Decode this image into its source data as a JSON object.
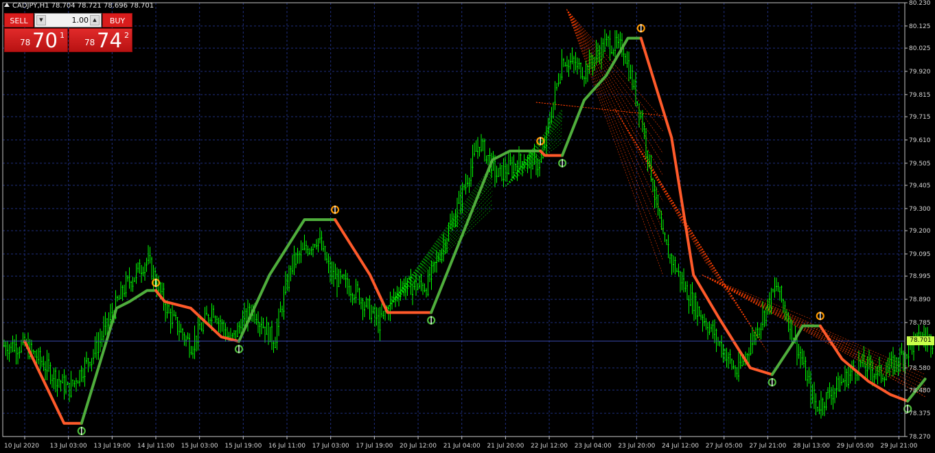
{
  "header": {
    "symbol_info": "CADJPY,H1  78.704 78.721 78.696 78.701"
  },
  "trade_panel": {
    "sell_label": "SELL",
    "buy_label": "BUY",
    "lot_value": "1.00",
    "sell_price_small": "78",
    "sell_price_big": "70",
    "sell_price_sup": "1",
    "buy_price_small": "78",
    "buy_price_big": "74",
    "buy_price_sup": "2"
  },
  "colors": {
    "background": "#000000",
    "grid": "#1f2f80",
    "bull_candle": "#00ff00",
    "trend_up": "#4fae3c",
    "trend_down": "#ff5a2a",
    "fan_up": "#00c800",
    "fan_down": "#ff4000",
    "current_price_bg": "#c9ff4a",
    "panel_red": "#d91c1c",
    "signal_icon": "#ff9900"
  },
  "chart_data": {
    "type": "line",
    "title": "",
    "xlabel": "",
    "ylabel": "",
    "ylim": [
      78.27,
      80.23
    ],
    "grid": true,
    "y_ticks": [
      "80.230",
      "80.125",
      "80.025",
      "79.920",
      "79.815",
      "79.715",
      "79.610",
      "79.505",
      "79.405",
      "79.300",
      "79.200",
      "79.095",
      "78.995",
      "78.890",
      "78.785",
      "78.580",
      "78.480",
      "78.375",
      "78.270"
    ],
    "current_price": "78.701",
    "x_ticks": [
      "10 Jul 2020",
      "13 Jul 03:00",
      "13 Jul 19:00",
      "14 Jul 11:00",
      "15 Jul 03:00",
      "15 Jul 19:00",
      "16 Jul 11:00",
      "17 Jul 03:00",
      "17 Jul 19:00",
      "20 Jul 12:00",
      "21 Jul 04:00",
      "21 Jul 20:00",
      "22 Jul 12:00",
      "23 Jul 04:00",
      "23 Jul 20:00",
      "24 Jul 12:00",
      "27 Jul 05:00",
      "27 Jul 21:00",
      "28 Jul 13:00",
      "29 Jul 05:00",
      "29 Jul 21:00"
    ],
    "price_series": [
      {
        "x": 0,
        "y": 78.68
      },
      {
        "x": 1,
        "y": 78.48
      },
      {
        "x": 1.6,
        "y": 78.66
      },
      {
        "x": 2.3,
        "y": 78.95
      },
      {
        "x": 2.8,
        "y": 79.07
      },
      {
        "x": 3.3,
        "y": 78.82
      },
      {
        "x": 3.8,
        "y": 78.68
      },
      {
        "x": 4.3,
        "y": 78.85
      },
      {
        "x": 4.7,
        "y": 78.7
      },
      {
        "x": 5.2,
        "y": 78.85
      },
      {
        "x": 5.7,
        "y": 78.7
      },
      {
        "x": 6.1,
        "y": 79.05
      },
      {
        "x": 6.7,
        "y": 79.17
      },
      {
        "x": 7.0,
        "y": 79.0
      },
      {
        "x": 7.6,
        "y": 78.92
      },
      {
        "x": 8.1,
        "y": 78.78
      },
      {
        "x": 8.6,
        "y": 78.95
      },
      {
        "x": 9.2,
        "y": 78.95
      },
      {
        "x": 9.8,
        "y": 79.25
      },
      {
        "x": 10.4,
        "y": 79.6
      },
      {
        "x": 10.8,
        "y": 79.45
      },
      {
        "x": 11.4,
        "y": 79.52
      },
      {
        "x": 11.8,
        "y": 79.5
      },
      {
        "x": 12.3,
        "y": 79.98
      },
      {
        "x": 12.8,
        "y": 79.92
      },
      {
        "x": 13.3,
        "y": 80.05
      },
      {
        "x": 13.7,
        "y": 80.02
      },
      {
        "x": 14.1,
        "y": 79.72
      },
      {
        "x": 14.6,
        "y": 79.15
      },
      {
        "x": 15.2,
        "y": 78.9
      },
      {
        "x": 15.8,
        "y": 78.72
      },
      {
        "x": 16.3,
        "y": 78.55
      },
      {
        "x": 16.8,
        "y": 78.78
      },
      {
        "x": 17.2,
        "y": 78.95
      },
      {
        "x": 17.6,
        "y": 78.72
      },
      {
        "x": 18.1,
        "y": 78.4
      },
      {
        "x": 18.6,
        "y": 78.5
      },
      {
        "x": 19.1,
        "y": 78.6
      },
      {
        "x": 19.6,
        "y": 78.55
      },
      {
        "x": 20.0,
        "y": 78.62
      },
      {
        "x": 20.5,
        "y": 78.72
      },
      {
        "x": 20.8,
        "y": 78.7
      }
    ],
    "trend_segments": [
      {
        "dir": "down",
        "points": [
          [
            0,
            78.7
          ],
          [
            0.9,
            78.33
          ],
          [
            1.3,
            78.33
          ]
        ]
      },
      {
        "dir": "up",
        "points": [
          [
            1.3,
            78.33
          ],
          [
            2.1,
            78.85
          ],
          [
            2.4,
            78.88
          ],
          [
            2.8,
            78.93
          ],
          [
            3.0,
            78.93
          ]
        ]
      },
      {
        "dir": "down",
        "points": [
          [
            3.0,
            78.93
          ],
          [
            3.2,
            78.88
          ],
          [
            3.8,
            78.85
          ],
          [
            4.5,
            78.72
          ],
          [
            4.9,
            78.7
          ]
        ]
      },
      {
        "dir": "up",
        "points": [
          [
            4.9,
            78.7
          ],
          [
            5.6,
            79.0
          ],
          [
            6.4,
            79.25
          ],
          [
            7.1,
            79.25
          ]
        ]
      },
      {
        "dir": "down",
        "points": [
          [
            7.1,
            79.25
          ],
          [
            7.9,
            79.0
          ],
          [
            8.3,
            78.83
          ],
          [
            9.3,
            78.83
          ]
        ]
      },
      {
        "dir": "up",
        "points": [
          [
            9.3,
            78.83
          ],
          [
            10.7,
            79.52
          ],
          [
            11.1,
            79.56
          ],
          [
            11.8,
            79.56
          ]
        ]
      },
      {
        "dir": "down",
        "points": [
          [
            11.8,
            79.56
          ],
          [
            11.9,
            79.54
          ],
          [
            12.3,
            79.54
          ]
        ]
      },
      {
        "dir": "up",
        "points": [
          [
            12.3,
            79.54
          ],
          [
            12.8,
            79.79
          ],
          [
            13.3,
            79.9
          ],
          [
            13.8,
            80.07
          ],
          [
            14.1,
            80.07
          ]
        ]
      },
      {
        "dir": "down",
        "points": [
          [
            14.1,
            80.07
          ],
          [
            14.8,
            79.62
          ],
          [
            15.3,
            79.0
          ],
          [
            15.9,
            78.8
          ],
          [
            16.6,
            78.58
          ],
          [
            17.1,
            78.55
          ]
        ]
      },
      {
        "dir": "up",
        "points": [
          [
            17.1,
            78.55
          ],
          [
            17.6,
            78.7
          ],
          [
            17.8,
            78.77
          ],
          [
            18.2,
            78.77
          ]
        ]
      },
      {
        "dir": "down",
        "points": [
          [
            18.2,
            78.77
          ],
          [
            18.7,
            78.62
          ],
          [
            19.3,
            78.52
          ],
          [
            19.8,
            78.46
          ],
          [
            20.2,
            78.43
          ]
        ]
      },
      {
        "dir": "up",
        "points": [
          [
            20.2,
            78.43
          ],
          [
            20.6,
            78.53
          ]
        ]
      }
    ],
    "signals": [
      {
        "kind": "down",
        "x": 3.0,
        "y": 78.94
      },
      {
        "kind": "up",
        "x": 1.3,
        "y": 78.32
      },
      {
        "kind": "up",
        "x": 4.9,
        "y": 78.69
      },
      {
        "kind": "down",
        "x": 7.1,
        "y": 79.27
      },
      {
        "kind": "up",
        "x": 9.3,
        "y": 78.82
      },
      {
        "kind": "down",
        "x": 11.8,
        "y": 79.58
      },
      {
        "kind": "up",
        "x": 12.3,
        "y": 79.53
      },
      {
        "kind": "down",
        "x": 14.1,
        "y": 80.09
      },
      {
        "kind": "up",
        "x": 17.1,
        "y": 78.54
      },
      {
        "kind": "down",
        "x": 18.2,
        "y": 78.79
      },
      {
        "kind": "up",
        "x": 20.2,
        "y": 78.42
      }
    ],
    "fans": [
      {
        "dir": "up",
        "origin": [
          8.3,
          78.85
        ],
        "targets": [
          [
            10.7,
            79.3
          ],
          [
            10.7,
            79.42
          ],
          [
            10.7,
            79.5
          ]
        ]
      },
      {
        "dir": "up",
        "origin": [
          11.0,
          79.4
        ],
        "targets": [
          [
            12.3,
            79.6
          ],
          [
            12.3,
            79.7
          ],
          [
            12.3,
            79.75
          ]
        ]
      },
      {
        "dir": "down",
        "origin": [
          11.7,
          79.78
        ],
        "targets": [
          [
            14.6,
            79.72
          ]
        ]
      },
      {
        "dir": "down",
        "origin": [
          12.4,
          80.2
        ],
        "targets": [
          [
            14.6,
            79.7
          ],
          [
            14.6,
            79.4
          ],
          [
            14.6,
            79.0
          ]
        ]
      },
      {
        "dir": "down",
        "origin": [
          13.5,
          79.75
        ],
        "targets": [
          [
            15.6,
            79.05
          ],
          [
            16.5,
            78.8
          ],
          [
            17.0,
            78.65
          ]
        ]
      },
      {
        "dir": "down",
        "origin": [
          15.5,
          79.0
        ],
        "targets": [
          [
            20.6,
            78.55
          ],
          [
            20.6,
            78.45
          ],
          [
            18.0,
            78.8
          ]
        ]
      }
    ]
  }
}
